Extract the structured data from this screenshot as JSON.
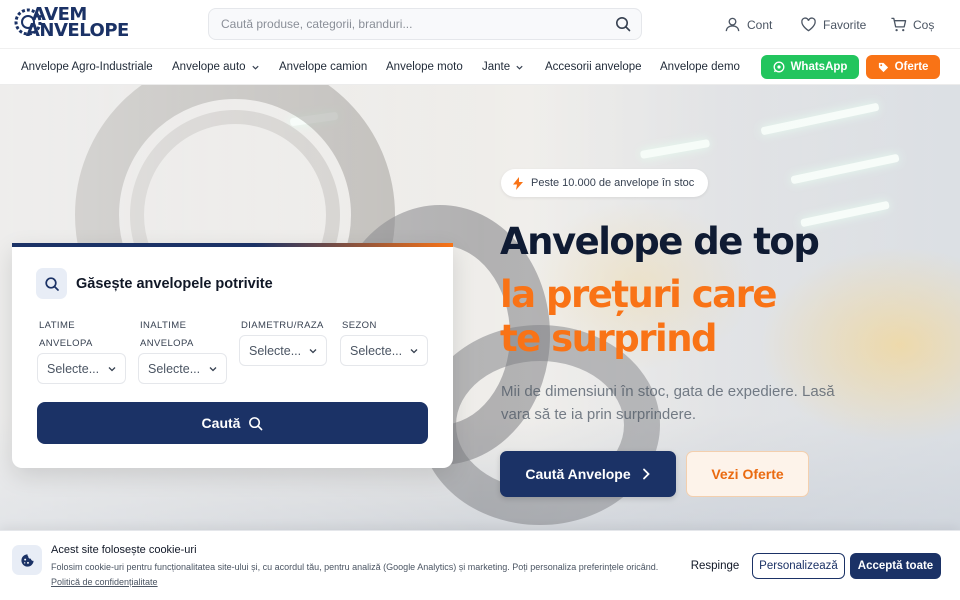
{
  "header": {
    "logo_line1": "AVEM",
    "logo_line2": "ANVELOPE",
    "search_placeholder": "Caută produse, categorii, branduri...",
    "account_label": "Cont",
    "favorites_label": "Favorite",
    "cart_label": "Coș"
  },
  "nav": {
    "items": [
      {
        "label": "Anvelope Agro-Industriale",
        "has_dropdown": false
      },
      {
        "label": "Anvelope auto",
        "has_dropdown": true
      },
      {
        "label": "Anvelope camion",
        "has_dropdown": false
      },
      {
        "label": "Anvelope moto",
        "has_dropdown": false
      },
      {
        "label": "Jante",
        "has_dropdown": true
      },
      {
        "label": "Accesorii anvelope",
        "has_dropdown": false
      },
      {
        "label": "Anvelope demo",
        "has_dropdown": false
      }
    ],
    "whatsapp_label": "WhatsApp",
    "offers_label": "Oferte"
  },
  "search_card": {
    "title": "Găsește anvelopele potrivite",
    "fields": [
      {
        "label_line1": "LATIME",
        "label_line2": "ANVELOPA",
        "value": "Selecte..."
      },
      {
        "label_line1": "INALTIME",
        "label_line2": "ANVELOPA",
        "value": "Selecte..."
      },
      {
        "label_line1": "DIAMETRU/RAZA",
        "label_line2": "",
        "value": "Selecte..."
      },
      {
        "label_line1": "SEZON",
        "label_line2": "",
        "value": "Selecte..."
      }
    ],
    "button_label": "Caută"
  },
  "hero": {
    "badge_text": "Peste 10.000 de anvelope în stoc",
    "headline_line1": "Anvelope de top",
    "headline_line2": "la prețuri care",
    "headline_line3": "te surprind",
    "subtitle": "Mii de dimensiuni în stoc, gata de expediere. Lasă vara să te ia prin surprindere.",
    "primary_button": "Caută Anvelope",
    "secondary_button": "Vezi Oferte"
  },
  "cookie": {
    "title": "Acest site folosește cookie-uri",
    "text": "Folosim cookie-uri pentru funcționalitatea site-ului și, cu acordul tău, pentru analiză (Google Analytics) și marketing. Poți personaliza preferințele oricând.",
    "policy_link": "Politică de confidențialitate",
    "reject_label": "Respinge",
    "customize_label": "Personalizează",
    "accept_label": "Acceptă toate"
  },
  "colors": {
    "brand_navy": "#1b3266",
    "accent_orange": "#f97316",
    "whatsapp_green": "#22c55e"
  }
}
